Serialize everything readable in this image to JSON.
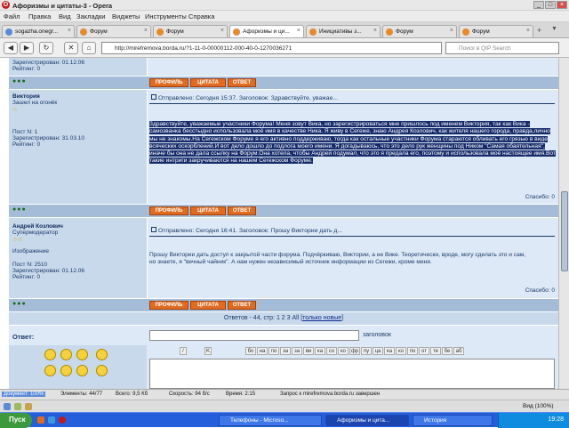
{
  "window": {
    "title": "Афоризмы и цитаты-3 - Opera",
    "min": "_",
    "max": "□",
    "close": "×"
  },
  "menu": [
    "Файл",
    "Правка",
    "Вид",
    "Закладки",
    "Виджеты",
    "Инструменты",
    "Справка"
  ],
  "tabs": [
    {
      "label": "sogazha.onegr...",
      "active": false
    },
    {
      "label": "Форум",
      "active": false
    },
    {
      "label": "Форум",
      "active": false
    },
    {
      "label": "Афоризмы и ци...",
      "active": true
    },
    {
      "label": "Инициативы з...",
      "active": false
    },
    {
      "label": "Форум",
      "active": false
    },
    {
      "label": "Форум",
      "active": false
    }
  ],
  "nav": {
    "back": "◀",
    "forward": "▶",
    "reload": "↻",
    "stop": "✕",
    "home": "⌂",
    "url": "http://mirefremova.borda.ru/?1-11-0-00000112-000-40-0-1270036271",
    "search_placeholder": "Поиск в QIP Search"
  },
  "post0": {
    "registered": "Зарегистрирован: 01.12.06",
    "rating": "Рейтинг: 0",
    "dots": "●●●"
  },
  "buttons": {
    "profile": "ПРОФИЛЬ",
    "quote": "ЦИТАТА",
    "reply": "ОТВЕТ"
  },
  "post1": {
    "author": "Виктория",
    "status": "Зашел на огонёк",
    "star": "☆",
    "posts": "Пост N: 1",
    "registered": "Зарегистрирован: 31.03.10",
    "rating": "Рейтинг: 0",
    "header": "Отправлено: Сегодня 15:37. Заголовок: Здравствуйте, уважае...",
    "body": "Здравствуйте, уважаемые участники Форума! Меня зовут Вика, но зарегистрироваться мне пришлось под именем Виктория, так как Вика - самозванка бесстыдно использовала моё имя в качестве Ника. Я живу в Сегеже, знаю Андрея Козлович, как жителя нашего города, правда,лично мы не знакомы.На Сегежском Форуме я его активно поддерживаю, тогда как остальные участники Форума стараются обливать его грязью в виде всяческих оскорблений.И вот дело дошло до подлога моего имени. Я догадываюсь, что это дело рук женщины под Ником \"Самая обаятельная\", иначе бы она не дала ссылку на Форум.Она хотела, чтобы Андрей подумал, что это я предала его, поэтому и использовала моё настоящее имя.Вот такие интриги закручиваются на нашем Сегежском Форуме.",
    "thanks": "Спасибо: 0"
  },
  "post2": {
    "author": "Андрей Козлович",
    "status": "Супермодератор",
    "stars": "☆☆",
    "image": "Изображение",
    "posts": "Пост N: 2510",
    "registered": "Зарегистрирован: 01.12.06",
    "rating": "Рейтинг: 0",
    "header": "Отправлено: Сегодня 16:41. Заголовок: Прошу Виктории дать д...",
    "body": "Прошу Виктории дать доступ к закрытой части форума. Подчёркиваю, Виктории, а не Вике. Теоретически, вроде, могу сделать это и сам, но знаете, я \"вечный чайник\". А нам нужен независимый источник информации из Сегежи, кроме меня.",
    "thanks": "Спасибо: 0"
  },
  "pagination": {
    "text": "Ответов - 44, стр: 1 2 3 All",
    "link": "только новые"
  },
  "reply": {
    "label": "Ответ:",
    "title_label": "заголовок",
    "format": [
      "/",
      "K",
      "бо",
      "на",
      "по",
      "за",
      "за",
      "ви",
      "ка",
      "со",
      "ко",
      "фр",
      "пу",
      "ца",
      "ка",
      "ко",
      "по",
      "от",
      "те",
      "бе",
      "аб"
    ]
  },
  "status": {
    "doc": "Документ: 100%",
    "elements": "Элементы: 44/77",
    "total": "Всего: 9,5 Кб",
    "speed": "Скорость: 94 б/с",
    "time": "Время: 2:15",
    "msg": "Запрос к mirefremova.borda.ru завершен",
    "view": "Вид (100%)"
  },
  "taskbar": {
    "start": "Пуск",
    "items": [
      {
        "label": "Телефоны - Microso...",
        "active": false
      },
      {
        "label": "Афоризмы и цита...",
        "active": true
      },
      {
        "label": "История",
        "active": false
      }
    ],
    "clock": "19:28"
  },
  "colors": {
    "highlight": "#152a6a",
    "button": "#e06c22",
    "profile_bg": "#c9d9ec",
    "post_bg": "#dde9f6"
  }
}
